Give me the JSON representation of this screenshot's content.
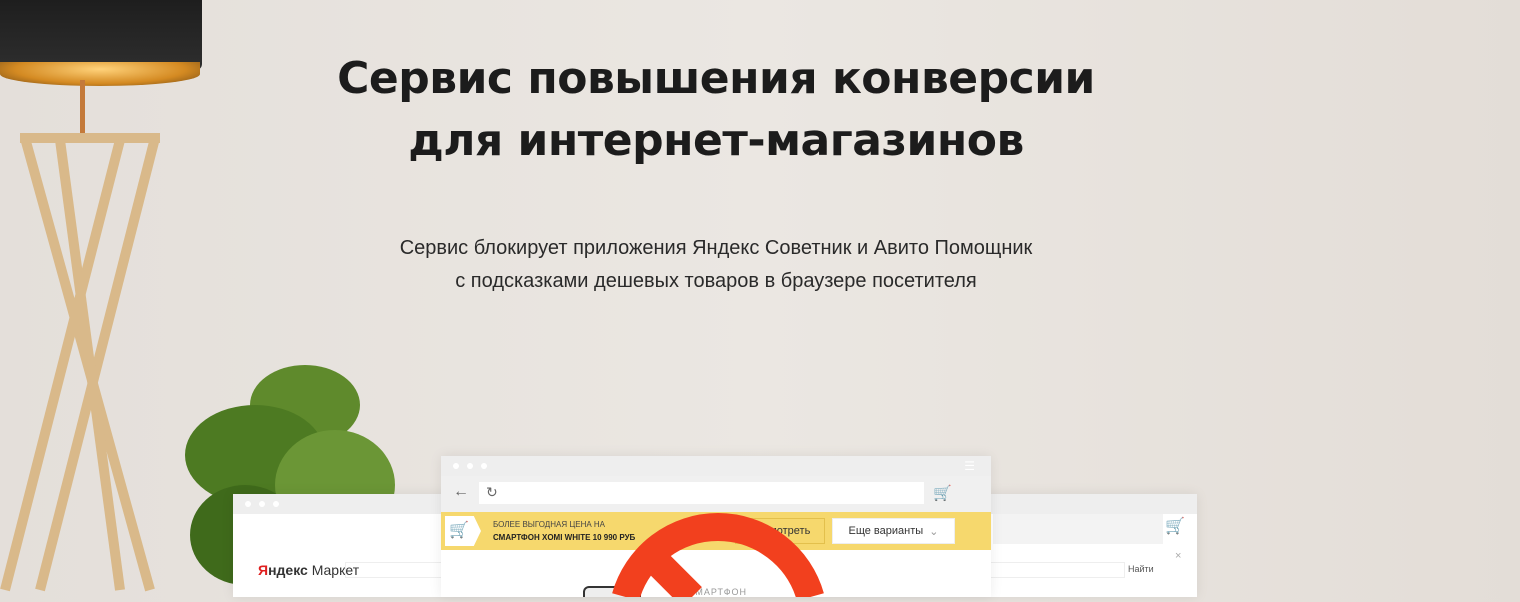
{
  "hero": {
    "title_line1": "Сервис повышения конверсии",
    "title_line2": "для интернет-магазинов",
    "subtitle_line1": "Сервис блокирует приложения Яндекс Советник и Авито Помощник",
    "subtitle_line2": "с подсказками дешевых товаров в браузере посетителя"
  },
  "mockup": {
    "advisor_line1": "БОЛЕЕ ВЫГОДНАЯ ЦЕНА НА",
    "advisor_line2": "СМАРТФОН XOMI WHITE 10 990 РУБ",
    "view_button": "Посмотреть",
    "more_button": "Еще варианты",
    "product_label": "СМАРТФОН",
    "market_logo_red": "Я",
    "market_logo_rest": "ндекс",
    "market_logo_word": "Маркет",
    "search_button": "Найти",
    "close": "×"
  },
  "colors": {
    "accent_yellow": "#f6d86d",
    "prohibit_red": "#f2401e",
    "cart_blue": "#3a6fc4"
  }
}
